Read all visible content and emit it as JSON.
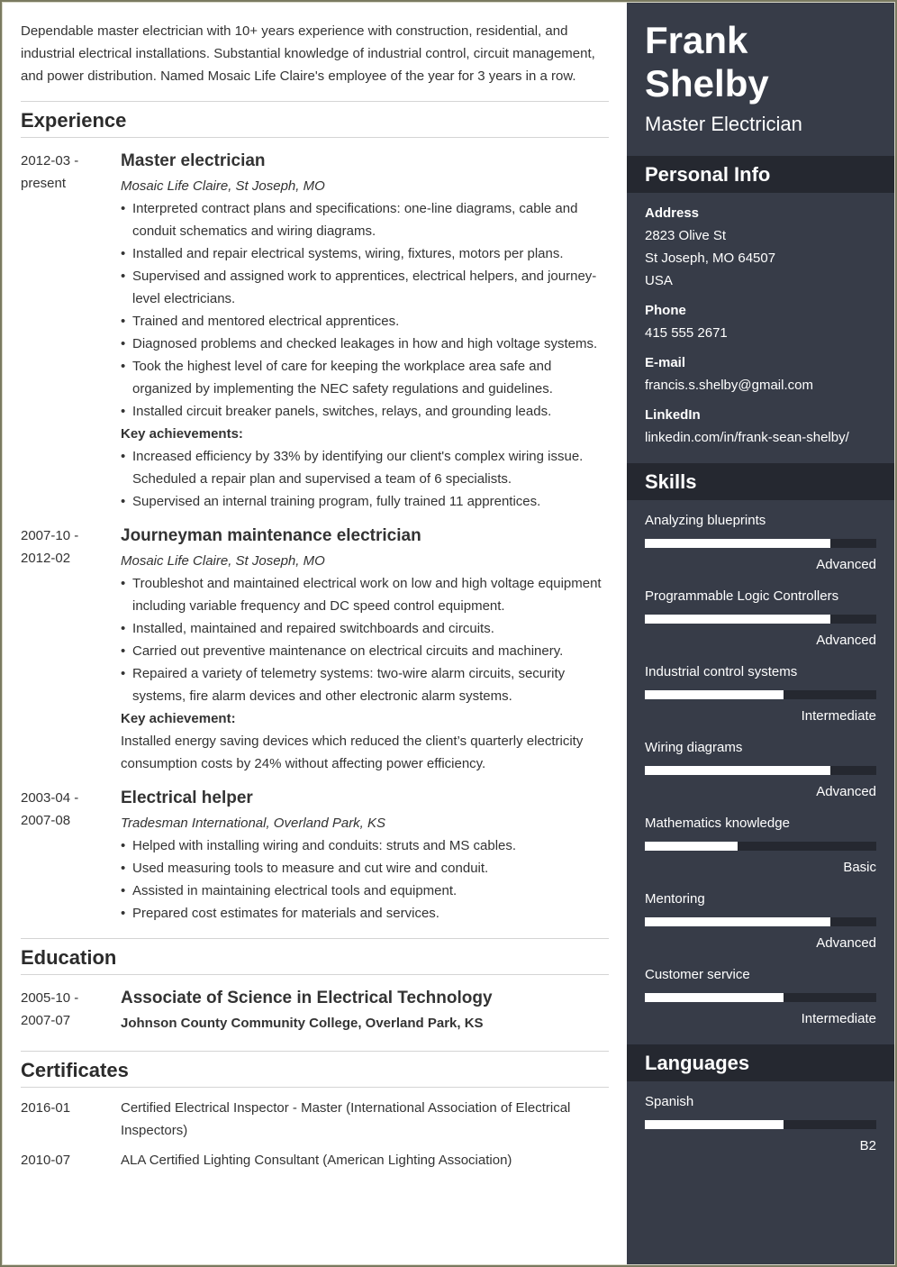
{
  "summary": "Dependable master electrician with 10+ years experience with construction, residential, and industrial electrical installations. Substantial knowledge of industrial control, circuit management, and power distribution. Named Mosaic Life Claire's employee of the year for 3 years in a row.",
  "experience": {
    "title": "Experience",
    "jobs": [
      {
        "date_start": "2012-03 -",
        "date_end": "present",
        "title": "Master electrician",
        "company": "Mosaic Life Claire, St Joseph, MO",
        "bullets": [
          "Interpreted contract plans and specifications: one-line diagrams, cable and conduit schematics and wiring diagrams.",
          "Installed and repair electrical systems, wiring, fixtures, motors per plans.",
          "Supervised and assigned work to apprentices, electrical helpers, and journey-level electricians.",
          "Trained and mentored electrical apprentices.",
          "Diagnosed problems and checked leakages in how and high voltage systems.",
          "Took the highest level of care for keeping the workplace area safe and organized by implementing the NEC safety regulations and guidelines.",
          "Installed circuit breaker panels, switches, relays, and grounding leads."
        ],
        "key_label": "Key achievements:",
        "key_bullets": [
          "Increased efficiency by 33% by identifying our client's complex wiring issue. Scheduled a repair plan and supervised a team of 6 specialists.",
          "Supervised an internal training program, fully trained 11 apprentices."
        ]
      },
      {
        "date_start": "2007-10 -",
        "date_end": "2012-02",
        "title": "Journeyman maintenance electrician",
        "company": "Mosaic Life Claire, St Joseph, MO",
        "bullets": [
          "Troubleshot and maintained electrical work on low and high voltage equipment including variable frequency and DC speed control equipment.",
          "Installed, maintained and repaired switchboards and circuits.",
          "Carried out preventive maintenance on electrical circuits and machinery.",
          "Repaired a variety of telemetry systems: two-wire alarm circuits, security systems, fire alarm devices and other electronic alarm systems."
        ],
        "key_label": "Key achievement:",
        "key_text": "Installed energy saving devices which reduced the client’s quarterly electricity consumption costs by 24% without affecting power efficiency."
      },
      {
        "date_start": "2003-04 -",
        "date_end": "2007-08",
        "title": "Electrical helper",
        "company": "Tradesman International, Overland Park, KS",
        "bullets": [
          "Helped with installing wiring and conduits: struts and MS cables.",
          "Used measuring tools to measure and cut wire and conduit.",
          "Assisted in maintaining electrical tools and equipment.",
          "Prepared cost estimates for materials and services."
        ]
      }
    ]
  },
  "education": {
    "title": "Education",
    "date_start": "2005-10 -",
    "date_end": "2007-07",
    "degree": "Associate of Science in Electrical Technology",
    "school": "Johnson County Community College, Overland Park, KS"
  },
  "certificates": {
    "title": "Certificates",
    "items": [
      {
        "date": "2016-01",
        "text": "Certified Electrical Inspector - Master (International Association of Electrical Inspectors)"
      },
      {
        "date": "2010-07",
        "text": "ALA Certified Lighting Consultant (American Lighting Association)"
      }
    ]
  },
  "sidebar": {
    "name": "Frank Shelby",
    "role": "Master Electrician",
    "personal_info": {
      "title": "Personal Info",
      "address_label": "Address",
      "address_lines": [
        "2823 Olive St",
        "St Joseph, MO 64507",
        "USA"
      ],
      "phone_label": "Phone",
      "phone": "415 555 2671",
      "email_label": "E-mail",
      "email": "francis.s.shelby@gmail.com",
      "linkedin_label": "LinkedIn",
      "linkedin": "linkedin.com/in/frank-sean-shelby/"
    },
    "skills": {
      "title": "Skills",
      "items": [
        {
          "name": "Analyzing blueprints",
          "level": "Advanced",
          "fraction": 0.8
        },
        {
          "name": "Programmable Logic Controllers",
          "level": "Advanced",
          "fraction": 0.8
        },
        {
          "name": "Industrial control systems",
          "level": "Intermediate",
          "fraction": 0.6
        },
        {
          "name": "Wiring diagrams",
          "level": "Advanced",
          "fraction": 0.8
        },
        {
          "name": "Mathematics knowledge",
          "level": "Basic",
          "fraction": 0.4
        },
        {
          "name": "Mentoring",
          "level": "Advanced",
          "fraction": 0.8
        },
        {
          "name": "Customer service",
          "level": "Intermediate",
          "fraction": 0.6
        }
      ]
    },
    "languages": {
      "title": "Languages",
      "items": [
        {
          "name": "Spanish",
          "level": "B2",
          "fraction": 0.6
        }
      ]
    }
  },
  "colors": {
    "sidebar_bg": "#373c48",
    "sidebar_heading_bg": "#252830",
    "bar_fill": "#ffffff",
    "bar_track": "#252830"
  }
}
